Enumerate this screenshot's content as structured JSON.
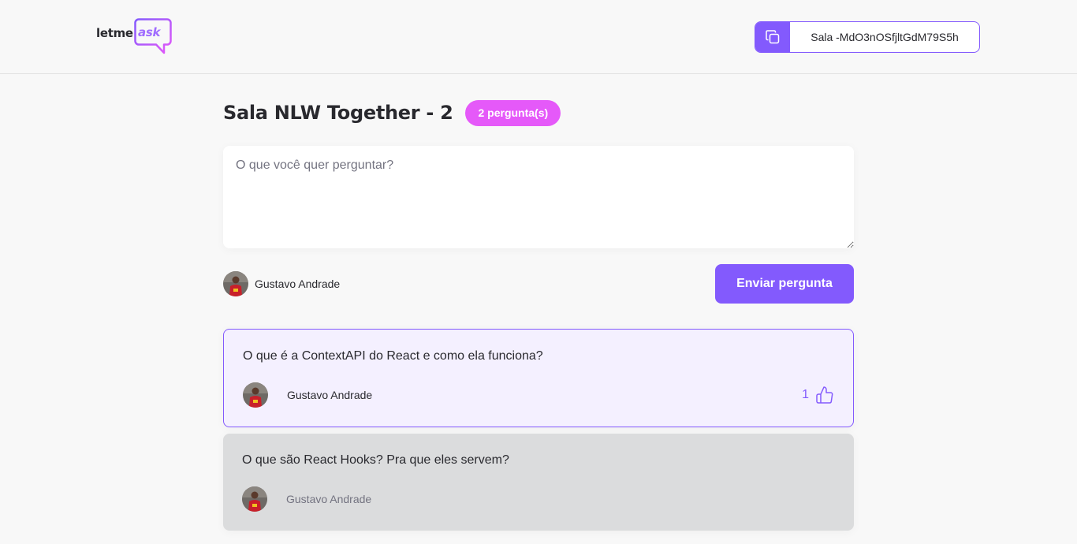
{
  "header": {
    "logo": {
      "letme": "letme",
      "ask": "ask"
    },
    "room_code": {
      "label": "Sala -MdO3nOSfjltGdM79S5h",
      "icon": "copy-icon"
    }
  },
  "room": {
    "title": "Sala NLW Together - 2",
    "question_count": "2 pergunta(s)"
  },
  "form": {
    "placeholder": "O que você quer perguntar?",
    "value": "",
    "user_name": "Gustavo Andrade",
    "submit_label": "Enviar pergunta"
  },
  "questions": [
    {
      "content": "O que é a ContextAPI do React e como ela funciona?",
      "author": "Gustavo Andrade",
      "like_count": "1",
      "state": "highlighted",
      "like_icon": "thumbs-up-icon"
    },
    {
      "content": "O que são React Hooks? Pra que eles servem?",
      "author": "Gustavo Andrade",
      "state": "answered"
    }
  ],
  "colors": {
    "primary": "#835afd",
    "badge": "#e559f9",
    "background": "#f8f8f8",
    "highlighted_bg": "#f4f0ff",
    "answered_bg": "#dbdcdd",
    "text": "#29292e",
    "muted": "#737380"
  }
}
